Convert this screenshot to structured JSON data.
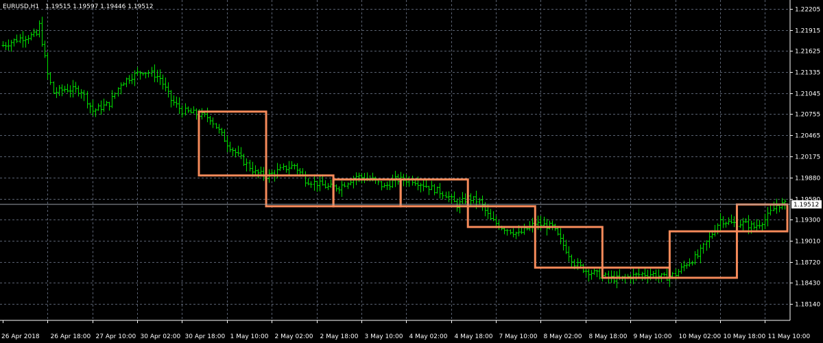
{
  "header": {
    "symbol": "EURUSD,H1",
    "ohlc": "1.19515 1.19597 1.19446 1.19512"
  },
  "current_price_label": "1.19512",
  "colors": {
    "background": "#000000",
    "grid": "#5a6272",
    "bars": "#00e000",
    "boxes": "#f58a5a",
    "axis_text": "#ffffff",
    "price_line": "#9aa0a8"
  },
  "chart_data": {
    "type": "ohlc",
    "title": "EURUSD,H1",
    "grid": true,
    "ylim": [
      1.1827,
      1.223
    ],
    "current_price": 1.19512,
    "y_ticks": [
      1.22205,
      1.21915,
      1.21625,
      1.21335,
      1.21045,
      1.20755,
      1.20465,
      1.20175,
      1.1988,
      1.1959,
      1.193,
      1.1901,
      1.1872,
      1.1843,
      1.1814
    ],
    "y_tick_labels": [
      "1.22205",
      "1.21915",
      "1.21625",
      "1.21335",
      "1.21045",
      "1.20755",
      "1.20465",
      "1.20175",
      "1.19880",
      "1.19590",
      "1.19300",
      "1.19010",
      "1.18720",
      "1.18430",
      "1.18140"
    ],
    "x_tick_labels": [
      "26 Apr 2018",
      "26 Apr 18:00",
      "27 Apr 10:00",
      "30 Apr 02:00",
      "30 Apr 18:00",
      "1 May 10:00",
      "2 May 02:00",
      "2 May 18:00",
      "3 May 10:00",
      "4 May 02:00",
      "4 May 18:00",
      "7 May 10:00",
      "8 May 02:00",
      "8 May 18:00",
      "9 May 10:00",
      "10 May 02:00",
      "10 May 18:00",
      "11 May 10:00"
    ],
    "x_tick_bar_index": [
      0,
      16,
      32,
      48,
      64,
      80,
      96,
      112,
      128,
      144,
      160,
      176,
      192,
      208,
      224,
      240,
      256,
      272
    ],
    "bar_count": 280,
    "close_path": [
      [
        0,
        1.217
      ],
      [
        6,
        1.218
      ],
      [
        12,
        1.2185
      ],
      [
        13,
        1.2198
      ],
      [
        16,
        1.213
      ],
      [
        18,
        1.2105
      ],
      [
        22,
        1.211
      ],
      [
        28,
        1.2108
      ],
      [
        32,
        1.208
      ],
      [
        38,
        1.209
      ],
      [
        42,
        1.2118
      ],
      [
        46,
        1.2128
      ],
      [
        50,
        1.2135
      ],
      [
        54,
        1.213
      ],
      [
        56,
        1.2125
      ],
      [
        60,
        1.2095
      ],
      [
        64,
        1.208
      ],
      [
        70,
        1.2075
      ],
      [
        74,
        1.207
      ],
      [
        80,
        1.2035
      ],
      [
        86,
        1.201
      ],
      [
        90,
        1.1995
      ],
      [
        94,
        1.199
      ],
      [
        100,
        1.2
      ],
      [
        104,
        1.2005
      ],
      [
        108,
        1.1985
      ],
      [
        112,
        1.198
      ],
      [
        116,
        1.1975
      ],
      [
        120,
        1.1975
      ],
      [
        126,
        1.199
      ],
      [
        132,
        1.1985
      ],
      [
        136,
        1.1975
      ],
      [
        140,
        1.1985
      ],
      [
        146,
        1.1985
      ],
      [
        152,
        1.1975
      ],
      [
        158,
        1.1965
      ],
      [
        162,
        1.195
      ],
      [
        166,
        1.196
      ],
      [
        170,
        1.1955
      ],
      [
        174,
        1.193
      ],
      [
        178,
        1.192
      ],
      [
        184,
        1.191
      ],
      [
        190,
        1.1925
      ],
      [
        196,
        1.192
      ],
      [
        200,
        1.1895
      ],
      [
        204,
        1.187
      ],
      [
        208,
        1.186
      ],
      [
        212,
        1.1855
      ],
      [
        216,
        1.185
      ],
      [
        220,
        1.1848
      ],
      [
        224,
        1.1852
      ],
      [
        228,
        1.1855
      ],
      [
        232,
        1.1855
      ],
      [
        236,
        1.185
      ],
      [
        240,
        1.1855
      ],
      [
        244,
        1.187
      ],
      [
        248,
        1.188
      ],
      [
        252,
        1.1905
      ],
      [
        256,
        1.193
      ],
      [
        260,
        1.1925
      ],
      [
        264,
        1.1925
      ],
      [
        268,
        1.192
      ],
      [
        272,
        1.193
      ],
      [
        276,
        1.195
      ],
      [
        279,
        1.19512
      ]
    ],
    "boxes": [
      {
        "bar_start": 70,
        "bar_end": 94,
        "high": 1.2079,
        "low": 1.1991
      },
      {
        "bar_start": 94,
        "bar_end": 118,
        "high": 1.1991,
        "low": 1.19485
      },
      {
        "bar_start": 118,
        "bar_end": 142,
        "high": 1.19855,
        "low": 1.19485
      },
      {
        "bar_start": 142,
        "bar_end": 166,
        "high": 1.19855,
        "low": 1.19485
      },
      {
        "bar_start": 166,
        "bar_end": 190,
        "high": 1.19485,
        "low": 1.192
      },
      {
        "bar_start": 190,
        "bar_end": 214,
        "high": 1.192,
        "low": 1.1864
      },
      {
        "bar_start": 214,
        "bar_end": 238,
        "high": 1.1864,
        "low": 1.185
      },
      {
        "bar_start": 238,
        "bar_end": 262,
        "high": 1.1914,
        "low": 1.185
      },
      {
        "bar_start": 262,
        "bar_end": 280,
        "high": 1.1951,
        "low": 1.1914
      }
    ]
  }
}
